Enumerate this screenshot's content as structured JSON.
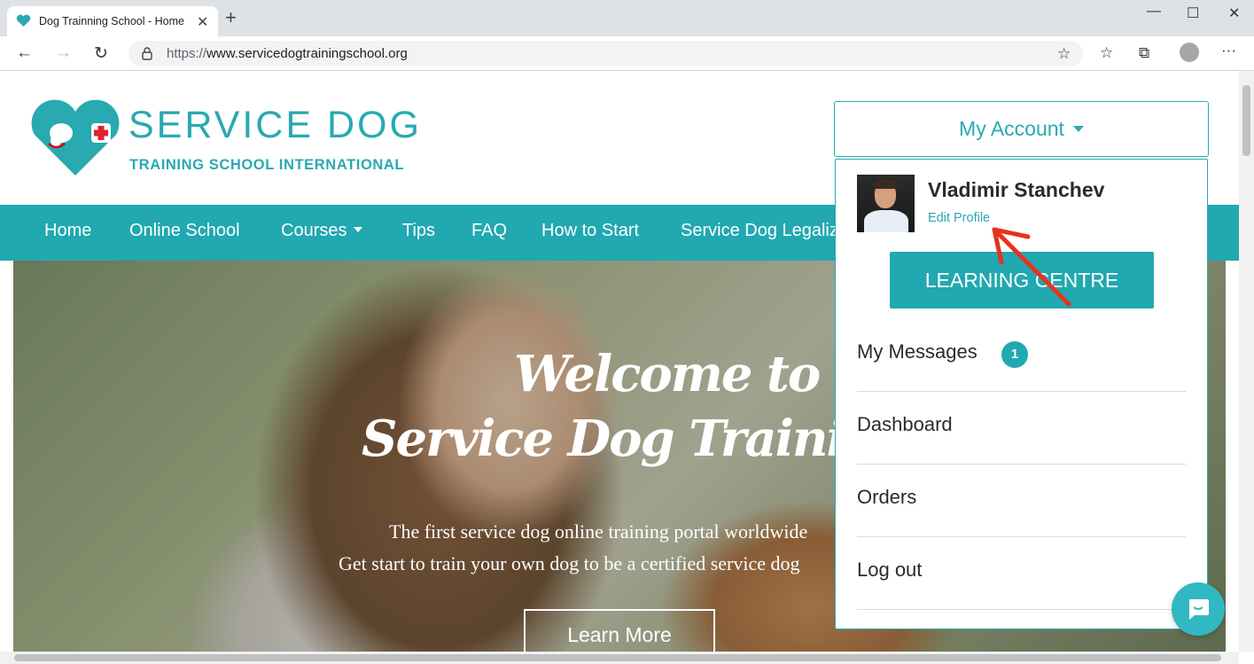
{
  "browser": {
    "tab_title": "Dog Trainning School - Home",
    "url_scheme": "https://",
    "url_host": "www.servicedogtrainingschool.org",
    "icons": [
      "paw-heart-favicon",
      "close-icon",
      "new-tab-icon",
      "minimize-icon",
      "maximize-icon",
      "window-close-icon",
      "back-icon",
      "forward-icon",
      "reload-icon",
      "lock-icon",
      "add-favorite-icon",
      "favorites-icon",
      "collections-icon",
      "profile-icon",
      "more-icon"
    ]
  },
  "header": {
    "brand_title": "SERVICE DOG",
    "brand_subtitle": "TRAINING SCHOOL INTERNATIONAL",
    "account_label": "My Account"
  },
  "nav": {
    "items": [
      {
        "label": "Home"
      },
      {
        "label": "Online School"
      },
      {
        "label": "Courses"
      },
      {
        "label": "Tips"
      },
      {
        "label": "FAQ"
      },
      {
        "label": "How to Start"
      },
      {
        "label": "Service Dog Legalization"
      }
    ]
  },
  "hero": {
    "heading_line1": "Welcome to",
    "heading_line2": "Service Dog Training School",
    "text_line1": "The first service dog online training portal worldwide",
    "text_line2": "Get start to train your own dog to be a certified service dog",
    "cta_label": "Learn More"
  },
  "account_menu": {
    "user_name": "Vladimir Stanchev",
    "edit_profile": "Edit Profile",
    "learning_centre": "LEARNING CENTRE",
    "items": [
      {
        "label": "My Messages",
        "badge": "1"
      },
      {
        "label": "Dashboard"
      },
      {
        "label": "Orders"
      },
      {
        "label": "Log out"
      }
    ]
  },
  "colors": {
    "brand": "#21a8b0",
    "annotation_arrow": "#e8321e"
  }
}
